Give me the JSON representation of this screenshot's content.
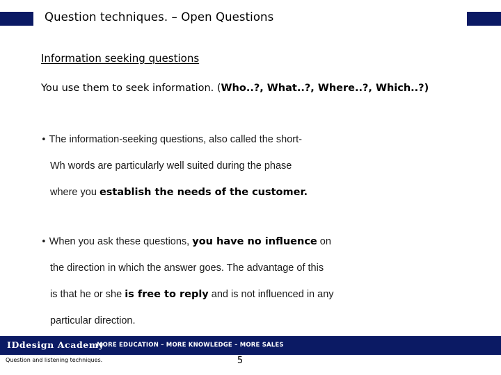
{
  "header": {
    "title": "Question techniques. – Open Questions",
    "accent_color": "#0b1a64"
  },
  "content": {
    "heading": "Information seeking questions",
    "intro": {
      "plain_prefix": "You use them to seek information. (",
      "bold_examples": "Who..?, What..?, Where..?, Which..?)"
    },
    "bullets": [
      {
        "marker": "•",
        "lines": [
          {
            "text": "The information-seeking questions, also called the short-",
            "bold": ""
          },
          {
            "text": "Wh words are particularly well suited during the phase",
            "bold": ""
          },
          {
            "text": "where you ",
            "bold": "establish the needs of the customer.",
            "tail": ""
          }
        ]
      },
      {
        "marker": "•",
        "lines": [
          {
            "text": "When you ask these questions, ",
            "bold": "you have no influence",
            "tail": " on"
          },
          {
            "text": "the direction in which the answer goes. The advantage of this",
            "bold": ""
          },
          {
            "text": "is that he or she ",
            "bold": "is free to reply",
            "tail": " and is not influenced in any"
          },
          {
            "text": "particular direction.",
            "bold": ""
          }
        ]
      }
    ]
  },
  "footer": {
    "brand": "IDdesign Academy",
    "tagline": "MORE EDUCATION – MORE KNOWLEDGE – MORE SALES",
    "note": "Question and listening techniques.",
    "page_number": "5",
    "bar_color": "#0b1a64"
  }
}
